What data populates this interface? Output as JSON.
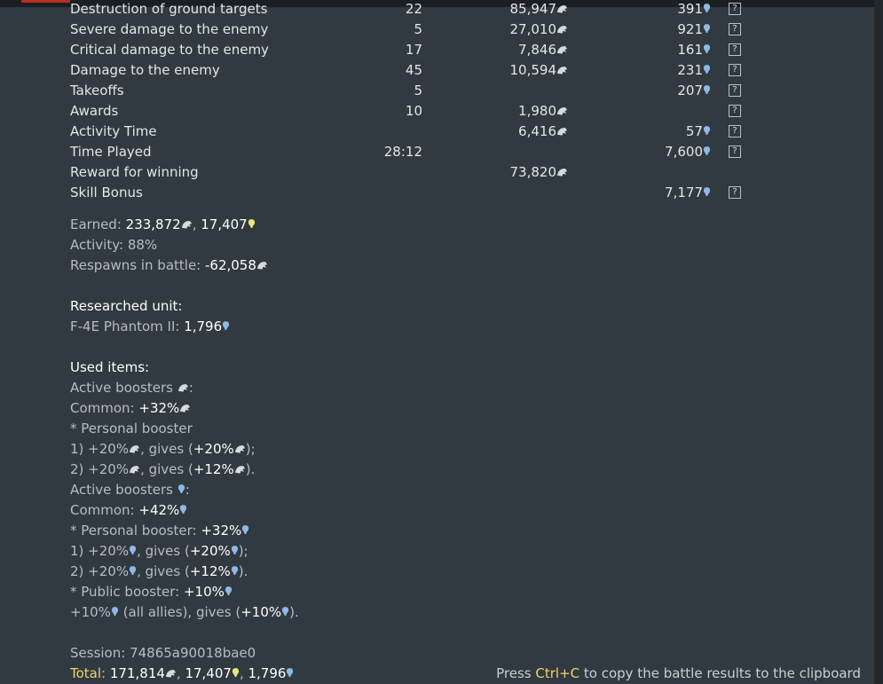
{
  "table": {
    "rows": [
      {
        "label": "Destruction of ground targets",
        "count": "22",
        "sl": "85,947",
        "rp": "391",
        "help": "?"
      },
      {
        "label": "Severe damage to the enemy",
        "count": "5",
        "sl": "27,010",
        "rp": "921",
        "help": "?"
      },
      {
        "label": "Critical damage to the enemy",
        "count": "17",
        "sl": "7,846",
        "rp": "161",
        "help": "?"
      },
      {
        "label": "Damage to the enemy",
        "count": "45",
        "sl": "10,594",
        "rp": "231",
        "help": "?"
      },
      {
        "label": "Takeoffs",
        "count": "5",
        "sl": "",
        "rp": "207",
        "help": "?"
      },
      {
        "label": "Awards",
        "count": "10",
        "sl": "1,980",
        "rp": "",
        "help": "?"
      },
      {
        "label": "Activity Time",
        "count": "",
        "sl": "6,416",
        "rp": "57",
        "help": "?"
      },
      {
        "label": "Time Played",
        "count": "28:12",
        "sl": "",
        "rp": "7,600",
        "help": "?"
      },
      {
        "label": "Reward for winning",
        "count": "",
        "sl": "73,820",
        "rp": "",
        "help": ""
      },
      {
        "label": "Skill Bonus",
        "count": "",
        "sl": "",
        "rp": "7,177",
        "help": "?"
      }
    ]
  },
  "summary": {
    "earned_label": "Earned: ",
    "earned_sl": "233,872",
    "earned_rp": "17,407",
    "activity_label": "Activity: ",
    "activity_value": "88%",
    "respawns_label": "Respawns in battle: ",
    "respawns_value": "-62,058"
  },
  "research": {
    "heading": "Researched unit:",
    "unit_label": "F-4E Phantom II: ",
    "unit_rp": "1,796"
  },
  "items": {
    "heading": "Used items:",
    "active_sl_label": "Active boosters ",
    "common_sl_label": "Common: ",
    "common_sl_value": "+32%",
    "personal_sl_label": "* Personal booster",
    "sl_b1_prefix": "1) +20%",
    "sl_b1_gives": ", gives (",
    "sl_b1_value": "+20%",
    "sl_b2_prefix": "2) +20%",
    "sl_b2_gives": ", gives (",
    "sl_b2_value": "+12%",
    "active_rp_label": "Active boosters ",
    "common_rp_label": "Common: ",
    "common_rp_value": "+42%",
    "personal_rp_label": "* Personal booster: ",
    "personal_rp_value": "+32%",
    "rp_b1_prefix": "1) +20%",
    "rp_b1_gives": ", gives (",
    "rp_b1_value": "+20%",
    "rp_b2_prefix": "2) +20%",
    "rp_b2_gives": ", gives (",
    "rp_b2_value": "+12%",
    "public_label": "* Public booster: ",
    "public_value": "+10%",
    "public_prefix": "+10%",
    "public_allies": " (all allies), gives (",
    "public_gives_value": "+10%"
  },
  "session": {
    "session_label": "Session: ",
    "session_id": "74865a90018bae0",
    "total_label": "Total",
    "total_sep": ": ",
    "total_sl": "171,814",
    "total_rp": "17,407",
    "total_research_rp": "1,796"
  },
  "hint": {
    "press": "Press ",
    "key": "Ctrl+C",
    "rest": " to copy the battle results to the clipboard"
  },
  "colors": {
    "silver_lions": "#d7dadd",
    "rp_blue": "#8fb8e6",
    "rp_yellow": "#e9e57a",
    "accent": "#f3d36b"
  },
  "icons": {
    "silver": "silver-lions-icon",
    "rp": "research-points-icon",
    "help": "help-icon"
  }
}
